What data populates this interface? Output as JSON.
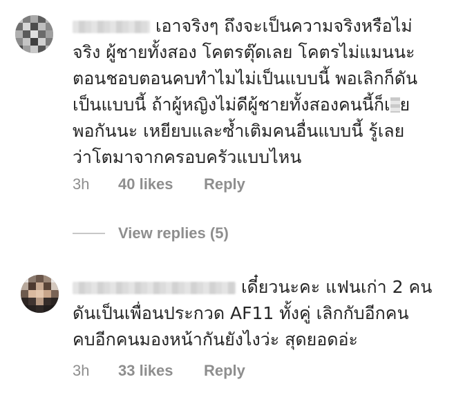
{
  "comments": [
    {
      "lines": [
        "เอาจริงๆ ถึงจะเป็นความจริงหรือไม่",
        "จริง ผู้ชายทั้งสอง โคตรตุ๊ดเลย โคตรไม่แมนนะ",
        "ตอนชอบตอนคบทำไมไม่เป็นแบบนี้ พอเลิกก็ดัน",
        "เป็นแบบนี้ ถ้าผู้หญิงไม่ดีผู้ชายทั้งสองคนนี้ก็เ",
        "พอกันนะ เหยียบและซ้ำเติมคนอื่นแบบนี้ รู้เลย",
        "ว่าโตมาจากครอบครัวแบบไหน"
      ],
      "line4_suffix": "ย",
      "time": "3h",
      "likes": "40 likes",
      "reply": "Reply"
    },
    {
      "lines": [
        "เดี๋ยวนะคะ แฟนเก่า 2 คน",
        "ดันเป็นเพื่อนประกวด AF11 ทั้งคู่ เลิกกับอีกคน",
        "คบอีกคนมองหน้ากันยังไงว่ะ สุดยอดอ่ะ"
      ],
      "time": "3h",
      "likes": "33 likes",
      "reply": "Reply"
    }
  ],
  "view_replies": "View replies (5)"
}
